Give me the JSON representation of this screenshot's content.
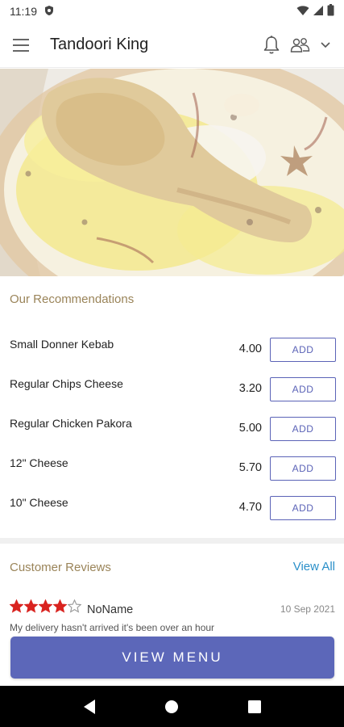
{
  "status_bar": {
    "time": "11:19"
  },
  "app_bar": {
    "title": "Tandoori King"
  },
  "recommendations": {
    "title": "Our Recommendations",
    "items": [
      {
        "name": "Small Donner Kebab",
        "price": "4.00",
        "button": "ADD"
      },
      {
        "name": "Regular Chips Cheese",
        "price": "3.20",
        "button": "ADD"
      },
      {
        "name": "Regular Chicken Pakora",
        "price": "5.00",
        "button": "ADD"
      },
      {
        "name": "12\" Cheese",
        "price": "5.70",
        "button": "ADD"
      },
      {
        "name": "10\" Cheese",
        "price": "4.70",
        "button": "ADD"
      }
    ]
  },
  "reviews": {
    "title": "Customer Reviews",
    "view_all": "View All",
    "items": [
      {
        "rating": 4,
        "max_rating": 5,
        "name": "NoName",
        "date": "10 Sep 2021",
        "text": "My delivery hasn't arrived it's been over an hour"
      }
    ]
  },
  "view_menu_label": "VIEW MENU",
  "colors": {
    "accent": "#5c67b9",
    "section_title": "#9a8459",
    "link": "#2a8fc9",
    "star": "#d9231f"
  },
  "icons": [
    "shield-icon",
    "wifi-icon",
    "signal-icon",
    "battery-icon",
    "hamburger-icon",
    "bell-icon",
    "users-icon",
    "chevron-down-icon",
    "star-icon",
    "back-icon",
    "home-icon",
    "recents-icon"
  ]
}
